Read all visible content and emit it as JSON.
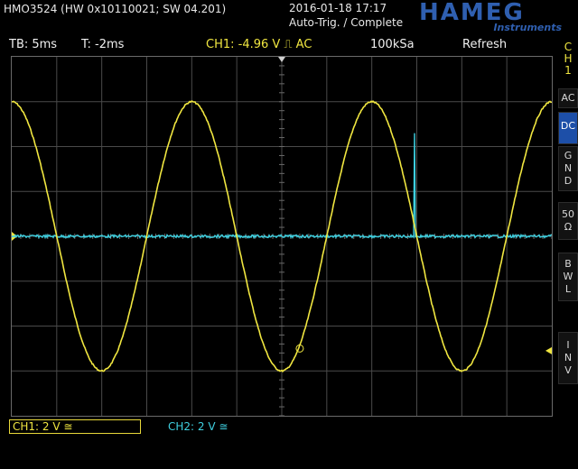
{
  "header": {
    "system_info": "HMO3524 (HW 0x10110021; SW 04.201)",
    "datetime": "2016-01-18 17:17",
    "trigger_state": "Auto-Trig. / Complete",
    "logo": {
      "name": "HAMEG",
      "subtitle": "Instruments",
      "color": "#2f5fb0"
    }
  },
  "status": {
    "timebase": "TB: 5ms",
    "trigger_time": "T: -2ms",
    "channel_info": "CH1: -4.96 V ⎍ AC",
    "sample_rate": "100kSa",
    "acquisition_mode": "Refresh"
  },
  "channels": {
    "ch1": {
      "label": "CH1: 2 V ≅",
      "color": "#f0e640"
    },
    "ch2": {
      "label": "CH2: 2 V ≅",
      "color": "#3fd0e0"
    }
  },
  "sidebar": {
    "channel_select": [
      "C",
      "H",
      "1"
    ],
    "buttons": [
      {
        "id": "ac",
        "lines": [
          "AC"
        ],
        "active": false
      },
      {
        "id": "dc",
        "lines": [
          "DC"
        ],
        "active": true
      },
      {
        "id": "gnd",
        "lines": [
          "G",
          "N",
          "D"
        ],
        "active": false
      },
      {
        "id": "ohm",
        "lines": [
          "50",
          "Ω"
        ],
        "active": false
      },
      {
        "id": "bwl",
        "lines": [
          "B",
          "W",
          "L"
        ],
        "active": false
      },
      {
        "id": "inv",
        "lines": [
          "I",
          "N",
          "V"
        ],
        "active": false
      }
    ]
  },
  "waveforms": {
    "ch1_periods_on_screen": 3,
    "ch1_amplitude_div": 3,
    "ch2_spike_position_div": 8.95,
    "ch2_spike_height_div": 2.3
  }
}
